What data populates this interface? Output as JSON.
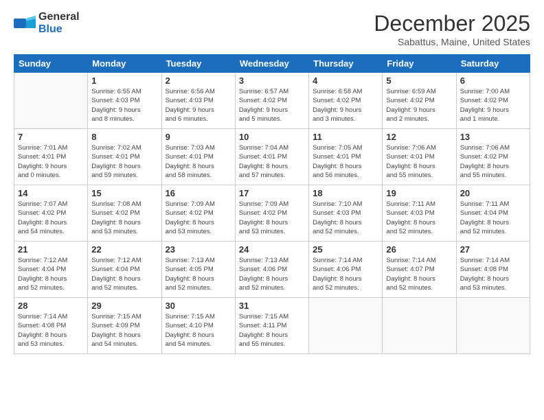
{
  "header": {
    "logo_general": "General",
    "logo_blue": "Blue",
    "month_title": "December 2025",
    "location": "Sabattus, Maine, United States"
  },
  "days_of_week": [
    "Sunday",
    "Monday",
    "Tuesday",
    "Wednesday",
    "Thursday",
    "Friday",
    "Saturday"
  ],
  "weeks": [
    [
      {
        "day": "",
        "info": ""
      },
      {
        "day": "1",
        "info": "Sunrise: 6:55 AM\nSunset: 4:03 PM\nDaylight: 9 hours\nand 8 minutes."
      },
      {
        "day": "2",
        "info": "Sunrise: 6:56 AM\nSunset: 4:03 PM\nDaylight: 9 hours\nand 6 minutes."
      },
      {
        "day": "3",
        "info": "Sunrise: 6:57 AM\nSunset: 4:02 PM\nDaylight: 9 hours\nand 5 minutes."
      },
      {
        "day": "4",
        "info": "Sunrise: 6:58 AM\nSunset: 4:02 PM\nDaylight: 9 hours\nand 3 minutes."
      },
      {
        "day": "5",
        "info": "Sunrise: 6:59 AM\nSunset: 4:02 PM\nDaylight: 9 hours\nand 2 minutes."
      },
      {
        "day": "6",
        "info": "Sunrise: 7:00 AM\nSunset: 4:02 PM\nDaylight: 9 hours\nand 1 minute."
      }
    ],
    [
      {
        "day": "7",
        "info": "Sunrise: 7:01 AM\nSunset: 4:01 PM\nDaylight: 9 hours\nand 0 minutes."
      },
      {
        "day": "8",
        "info": "Sunrise: 7:02 AM\nSunset: 4:01 PM\nDaylight: 8 hours\nand 59 minutes."
      },
      {
        "day": "9",
        "info": "Sunrise: 7:03 AM\nSunset: 4:01 PM\nDaylight: 8 hours\nand 58 minutes."
      },
      {
        "day": "10",
        "info": "Sunrise: 7:04 AM\nSunset: 4:01 PM\nDaylight: 8 hours\nand 57 minutes."
      },
      {
        "day": "11",
        "info": "Sunrise: 7:05 AM\nSunset: 4:01 PM\nDaylight: 8 hours\nand 56 minutes."
      },
      {
        "day": "12",
        "info": "Sunrise: 7:06 AM\nSunset: 4:01 PM\nDaylight: 8 hours\nand 55 minutes."
      },
      {
        "day": "13",
        "info": "Sunrise: 7:06 AM\nSunset: 4:02 PM\nDaylight: 8 hours\nand 55 minutes."
      }
    ],
    [
      {
        "day": "14",
        "info": "Sunrise: 7:07 AM\nSunset: 4:02 PM\nDaylight: 8 hours\nand 54 minutes."
      },
      {
        "day": "15",
        "info": "Sunrise: 7:08 AM\nSunset: 4:02 PM\nDaylight: 8 hours\nand 53 minutes."
      },
      {
        "day": "16",
        "info": "Sunrise: 7:09 AM\nSunset: 4:02 PM\nDaylight: 8 hours\nand 53 minutes."
      },
      {
        "day": "17",
        "info": "Sunrise: 7:09 AM\nSunset: 4:02 PM\nDaylight: 8 hours\nand 53 minutes."
      },
      {
        "day": "18",
        "info": "Sunrise: 7:10 AM\nSunset: 4:03 PM\nDaylight: 8 hours\nand 52 minutes."
      },
      {
        "day": "19",
        "info": "Sunrise: 7:11 AM\nSunset: 4:03 PM\nDaylight: 8 hours\nand 52 minutes."
      },
      {
        "day": "20",
        "info": "Sunrise: 7:11 AM\nSunset: 4:04 PM\nDaylight: 8 hours\nand 52 minutes."
      }
    ],
    [
      {
        "day": "21",
        "info": "Sunrise: 7:12 AM\nSunset: 4:04 PM\nDaylight: 8 hours\nand 52 minutes."
      },
      {
        "day": "22",
        "info": "Sunrise: 7:12 AM\nSunset: 4:04 PM\nDaylight: 8 hours\nand 52 minutes."
      },
      {
        "day": "23",
        "info": "Sunrise: 7:13 AM\nSunset: 4:05 PM\nDaylight: 8 hours\nand 52 minutes."
      },
      {
        "day": "24",
        "info": "Sunrise: 7:13 AM\nSunset: 4:06 PM\nDaylight: 8 hours\nand 52 minutes."
      },
      {
        "day": "25",
        "info": "Sunrise: 7:14 AM\nSunset: 4:06 PM\nDaylight: 8 hours\nand 52 minutes."
      },
      {
        "day": "26",
        "info": "Sunrise: 7:14 AM\nSunset: 4:07 PM\nDaylight: 8 hours\nand 52 minutes."
      },
      {
        "day": "27",
        "info": "Sunrise: 7:14 AM\nSunset: 4:08 PM\nDaylight: 8 hours\nand 53 minutes."
      }
    ],
    [
      {
        "day": "28",
        "info": "Sunrise: 7:14 AM\nSunset: 4:08 PM\nDaylight: 8 hours\nand 53 minutes."
      },
      {
        "day": "29",
        "info": "Sunrise: 7:15 AM\nSunset: 4:09 PM\nDaylight: 8 hours\nand 54 minutes."
      },
      {
        "day": "30",
        "info": "Sunrise: 7:15 AM\nSunset: 4:10 PM\nDaylight: 8 hours\nand 54 minutes."
      },
      {
        "day": "31",
        "info": "Sunrise: 7:15 AM\nSunset: 4:11 PM\nDaylight: 8 hours\nand 55 minutes."
      },
      {
        "day": "",
        "info": ""
      },
      {
        "day": "",
        "info": ""
      },
      {
        "day": "",
        "info": ""
      }
    ]
  ]
}
